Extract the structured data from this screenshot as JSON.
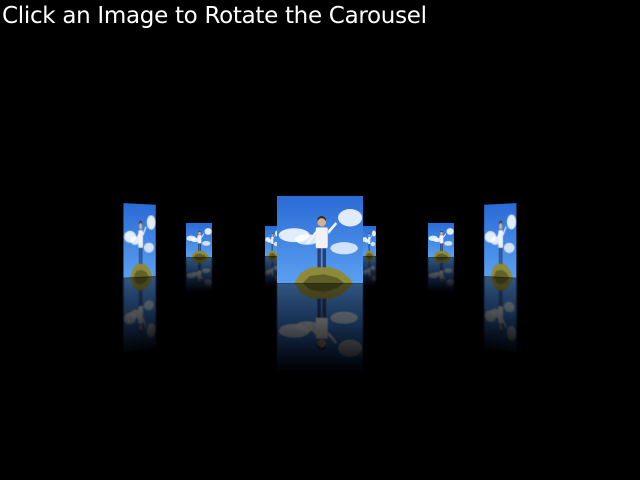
{
  "header": {
    "title": "Click an Image to Rotate the Carousel"
  },
  "carousel": {
    "image_subject": "person-standing-on-rock-under-blue-sky",
    "colors": {
      "sky_top": "#2a6bd6",
      "sky_bottom": "#5aa0f0",
      "cloud": "#ffffff",
      "rock": "#8d8a3a",
      "rock_dark": "#4f5020",
      "shirt": "#f2f2f2",
      "jeans": "#2b3f73"
    }
  }
}
